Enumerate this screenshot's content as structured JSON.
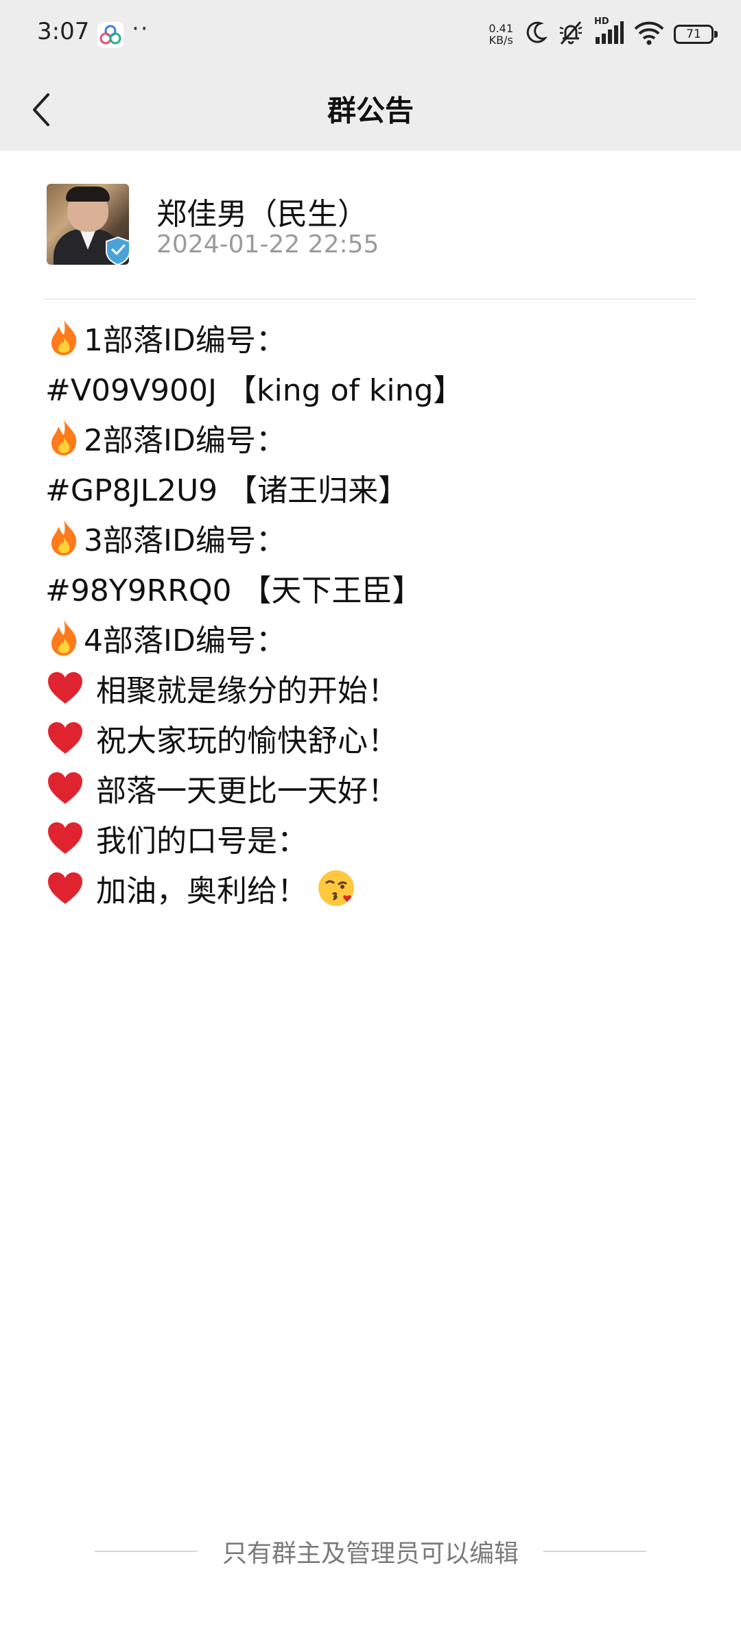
{
  "status_bar": {
    "time": "3:07",
    "dots": "··",
    "net_speed_value": "0.41",
    "net_speed_unit": "KB/s",
    "signal_badge": "HD",
    "battery_level": "71"
  },
  "header": {
    "title": "群公告",
    "back_icon": "chevron-left-icon"
  },
  "author": {
    "name": "郑佳男（民生）",
    "timestamp": "2024-01-22 22:55"
  },
  "announcement": {
    "lines": [
      {
        "icon": "fire-emoji",
        "text": "1部落ID编号："
      },
      {
        "icon": "",
        "text": "#V09V900J 【king of king】"
      },
      {
        "icon": "fire-emoji",
        "text": "2部落ID编号："
      },
      {
        "icon": "",
        "text": "#GP8JL2U9 【诸王归来】"
      },
      {
        "icon": "fire-emoji",
        "text": "3部落ID编号："
      },
      {
        "icon": "",
        "text": "#98Y9RRQ0 【天下王臣】"
      },
      {
        "icon": "fire-emoji",
        "text": "4部落ID编号："
      },
      {
        "icon": "heart-emoji",
        "text": "相聚就是缘分的开始！"
      },
      {
        "icon": "heart-emoji",
        "text": "祝大家玩的愉快舒心！"
      },
      {
        "icon": "heart-emoji",
        "text": "部落一天更比一天好！"
      },
      {
        "icon": "heart-emoji",
        "text": "我们的口号是："
      },
      {
        "icon": "heart-emoji",
        "text": "加油，奥利给！",
        "trailing_icon": "kiss-emoji"
      }
    ]
  },
  "footer": {
    "notice": "只有群主及管理员可以编辑"
  },
  "colors": {
    "header_bg": "#ededed",
    "page_bg": "#ffffff",
    "secondary_text": "#9a9a9a",
    "heart": "#e0242f",
    "fire": "#ff7a1a"
  }
}
